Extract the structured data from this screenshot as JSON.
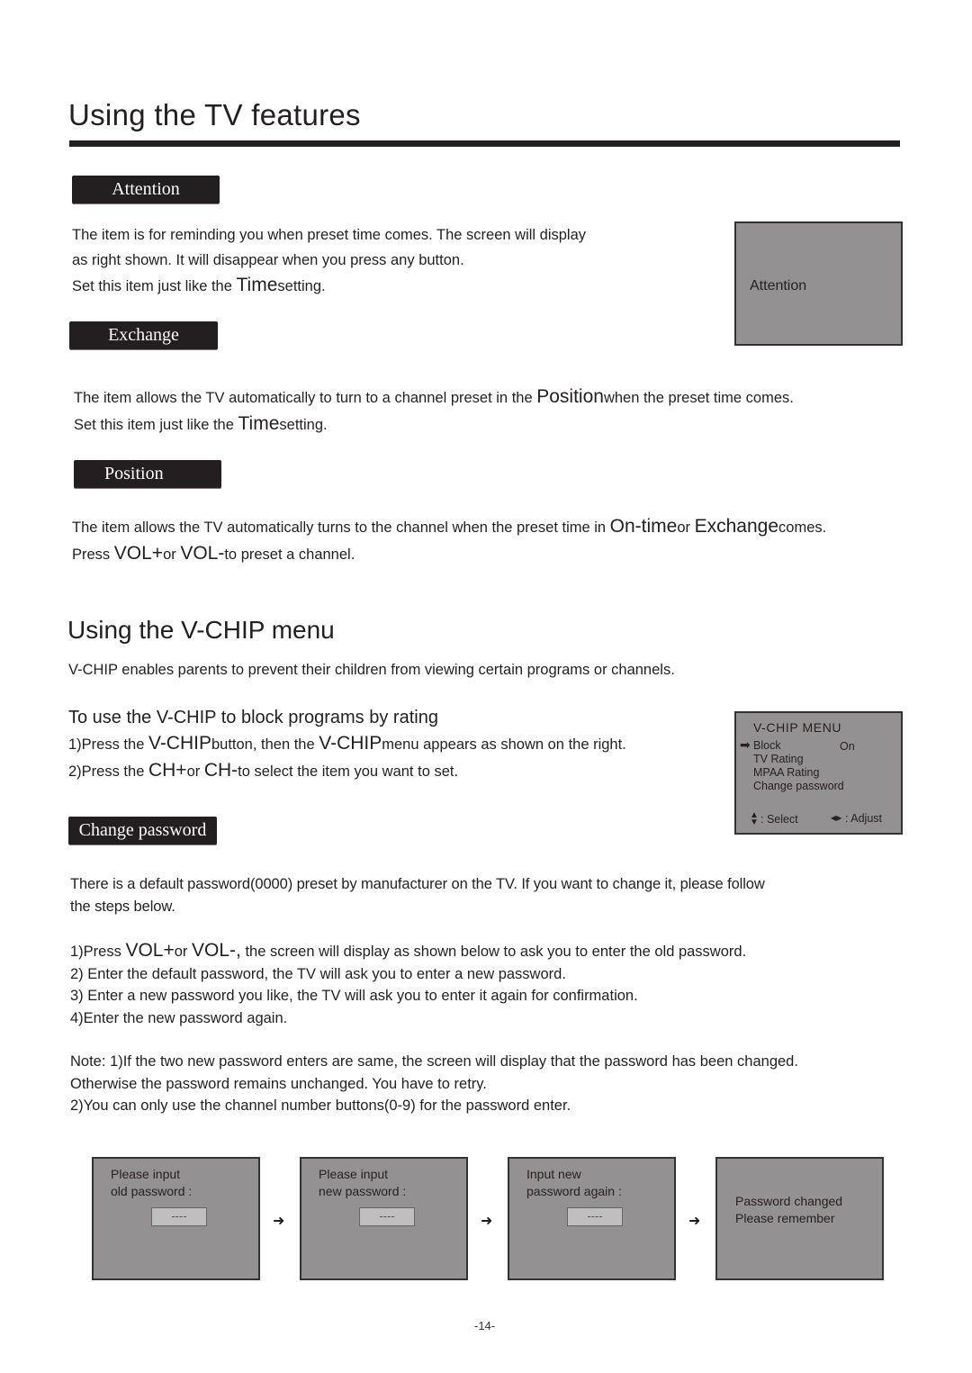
{
  "page": {
    "title": "Using the TV features",
    "page_number": "-14-"
  },
  "attention": {
    "tag": "Attention",
    "lines": [
      "The item is for reminding you when preset time comes. The screen will display",
      "as right shown. It will disappear when you press any button."
    ],
    "line3_pre": "Set this item just like the ",
    "line3_key": "Time",
    "line3_post": "setting.",
    "screen_text": "Attention"
  },
  "exchange": {
    "tag": "Exchange",
    "line1_pre": "The item allows  the TV automatically to turn to a channel preset in the ",
    "line1_key": "Position",
    "line1_post": "when the preset time comes.",
    "line2_pre": "Set this item just like the ",
    "line2_key": "Time",
    "line2_post": "setting."
  },
  "position": {
    "tag": "Position",
    "line1_pre": "The item allows  the TV automatically turns to the channel when the preset time in ",
    "line1_key1": "On-time",
    "line1_mid": "or ",
    "line1_key2": "Exchange",
    "line1_post": "comes.",
    "line2_pre": "Press ",
    "line2_key1": "VOL+",
    "line2_mid": "or ",
    "line2_key2": "VOL-",
    "line2_post": "to preset a channel."
  },
  "vchip": {
    "heading": "Using the V-CHIP menu",
    "intro": "V-CHIP enables parents to prevent their children from viewing certain programs or channels.",
    "subheading": "To use the V-CHIP  to block programs by rating",
    "step1_pre": "1)Press the ",
    "step1_key1": "V-CHIP",
    "step1_mid": "button, then  the ",
    "step1_key2": "V-CHIP",
    "step1_post": "menu appears as  shown on the right.",
    "step2_pre": "2)Press the ",
    "step2_key1": "CH+",
    "step2_mid": "or ",
    "step2_key2": "CH-",
    "step2_post": "to select the item you want to set.",
    "menu": {
      "title": "V-CHIP MENU",
      "items": [
        {
          "label": "Block",
          "value": "On",
          "selected": true
        },
        {
          "label": "TV Rating",
          "value": ""
        },
        {
          "label": "MPAA Rating",
          "value": ""
        },
        {
          "label": "Change password",
          "value": ""
        }
      ],
      "select_hint": ": Select",
      "adjust_hint": ": Adjust"
    }
  },
  "change_password": {
    "tag": "Change password",
    "intro_lines": [
      "There is a default password(0000) preset by manufacturer on the TV.  If you want to change it, please follow",
      " the steps below."
    ],
    "step1_pre": "1)Press ",
    "step1_key1": "VOL+",
    "step1_mid": "or ",
    "step1_key2": "VOL-,",
    "step1_post": "  the screen will display as shown below to ask you to enter  the old password.",
    "steps": [
      "2) Enter the default password, the TV will ask you to enter a new password.",
      "3) Enter a new password you like, the TV will ask you to enter it again for confirmation.",
      "4)Enter the new password again."
    ],
    "notes": [
      "Note:  1)If the two new password enters are same, the screen will display that the password has been changed.",
      "Otherwise  the password remains unchanged. You have to retry.",
      "2)You can only use the channel number buttons(0-9) for the password enter."
    ],
    "screens": [
      {
        "line1": "Please input",
        "line2": "old password  :",
        "field": "----"
      },
      {
        "line1": "Please input",
        "line2": "new password  :",
        "field": "----"
      },
      {
        "line1": "Input new",
        "line2": "password again  :",
        "field": "----"
      },
      {
        "line1": "Password changed",
        "line2": "Please remember"
      }
    ]
  }
}
